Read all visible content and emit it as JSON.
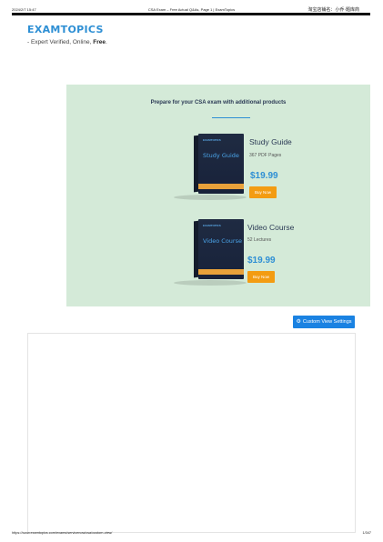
{
  "print_header": {
    "date": "2024/2/7 15:47",
    "title": "CSA Exam – Free Actual Q&As, Page 1 | ExamTopics",
    "watermark": "淘宝店铺名：小乔·题库商"
  },
  "logo": {
    "text": "EXAMTOPICS",
    "color": "#2e8fd4"
  },
  "tagline": {
    "prefix": "- Expert Verified, Online, ",
    "emphasis": "Free",
    "suffix": "."
  },
  "promo": {
    "heading": "Prepare for your CSA exam with additional products",
    "background": "#d4ead8",
    "products": [
      {
        "box_logo": "EXAMTOPICS",
        "box_title": "Study Guide",
        "title": "Study Guide",
        "meta": "367 PDF Pages",
        "price": "$19.99",
        "button": "Buy Now"
      },
      {
        "box_logo": "EXAMTOPICS",
        "box_title": "Video Course",
        "title": "Video Course",
        "meta": "52 Lectures",
        "price": "$19.99",
        "button": "Buy Now"
      }
    ]
  },
  "settings_button": {
    "icon": "gear-icon",
    "label": "Custom View Settings",
    "color": "#1a82e2"
  },
  "print_footer": {
    "url": "https://www.examtopics.com/exams/servicenow/csa/custom-view/",
    "page": "1/347"
  }
}
